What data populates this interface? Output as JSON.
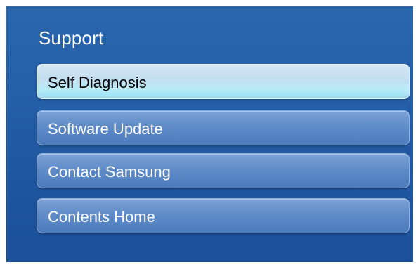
{
  "window": {
    "title": "Support"
  },
  "menu": {
    "items": [
      {
        "label": "Self Diagnosis",
        "selected": true
      },
      {
        "label": "Software Update",
        "selected": false
      },
      {
        "label": "Contact Samsung",
        "selected": false
      },
      {
        "label": "Contents Home",
        "selected": false
      }
    ]
  },
  "colors": {
    "panel_background": "#2560a8",
    "item_background": "#5f8bc8",
    "selected_item_background": "#c3deef",
    "text": "#ffffff",
    "selected_text": "#000000"
  }
}
